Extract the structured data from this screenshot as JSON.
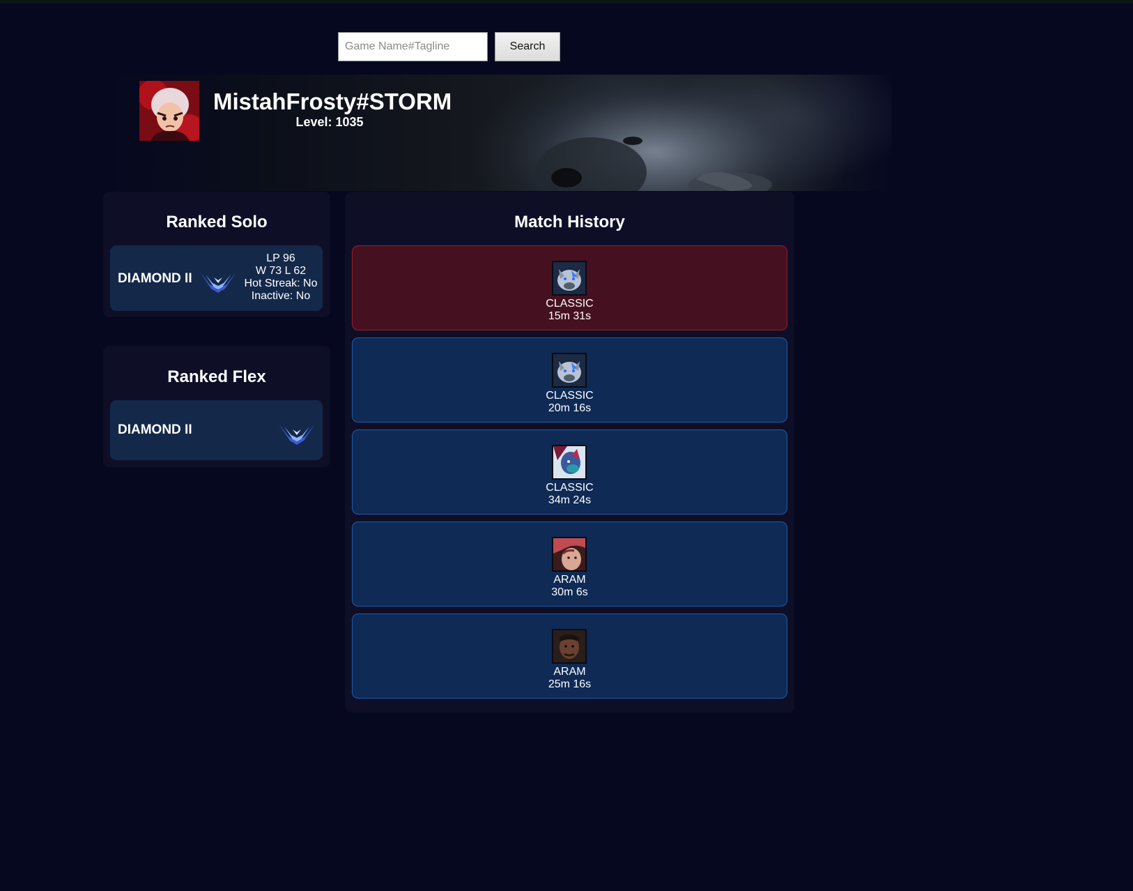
{
  "search": {
    "placeholder": "Game Name#Tagline",
    "button_label": "Search"
  },
  "profile": {
    "name": "MistahFrosty#STORM",
    "level": "Level: 1035"
  },
  "ranked_solo": {
    "title": "Ranked Solo",
    "tier": "DIAMOND II",
    "lp": "LP 96",
    "record": "W 73 L 62",
    "hot_streak": "Hot Streak: No",
    "inactive": "Inactive: No"
  },
  "ranked_flex": {
    "title": "Ranked Flex",
    "tier": "DIAMOND II"
  },
  "match_history": {
    "title": "Match History",
    "matches": [
      {
        "mode": "CLASSIC",
        "duration": "15m 31s",
        "result": "loss",
        "champion_icon": "white-wolf-champion-icon"
      },
      {
        "mode": "CLASSIC",
        "duration": "20m 16s",
        "result": "win",
        "champion_icon": "white-wolf-champion-icon"
      },
      {
        "mode": "CLASSIC",
        "duration": "34m 24s",
        "result": "win",
        "champion_icon": "troll-champion-icon"
      },
      {
        "mode": "ARAM",
        "duration": "30m 6s",
        "result": "win",
        "champion_icon": "red-haired-champion-icon"
      },
      {
        "mode": "ARAM",
        "duration": "25m 16s",
        "result": "win",
        "champion_icon": "dark-champion-icon"
      }
    ]
  },
  "colors": {
    "page_background": "#060820",
    "panel_background": "#0e0f27",
    "rank_card_background": "#14284a",
    "win_card": "#0e2a55",
    "loss_card": "#451120"
  }
}
